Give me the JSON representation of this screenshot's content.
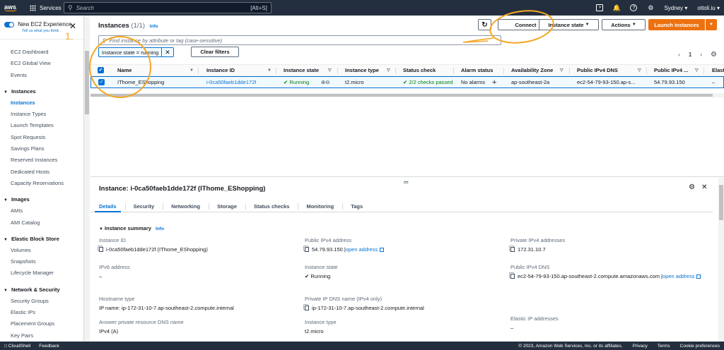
{
  "topbar": {
    "logo": "aws",
    "services_label": "Services",
    "search_placeholder": "Search",
    "search_shortcut": "[Alt+S]",
    "region": "Sydney",
    "user": "ottoli.iu",
    "icons": [
      "terminal-icon",
      "bell-icon",
      "help-icon",
      "gear-icon"
    ]
  },
  "sidebar": {
    "toggle_title": "New EC2 Experience",
    "toggle_sub": "Tell us what you think",
    "top_items": [
      "EC2 Dashboard",
      "EC2 Global View",
      "Events"
    ],
    "sections": [
      {
        "title": "Instances",
        "items": [
          "Instances",
          "Instance Types",
          "Launch Templates",
          "Spot Requests",
          "Savings Plans",
          "Reserved Instances",
          "Dedicated Hosts",
          "Capacity Reservations"
        ]
      },
      {
        "title": "Images",
        "items": [
          "AMIs",
          "AMI Catalog"
        ]
      },
      {
        "title": "Elastic Block Store",
        "items": [
          "Volumes",
          "Snapshots",
          "Lifecycle Manager"
        ]
      },
      {
        "title": "Network & Security",
        "items": [
          "Security Groups",
          "Elastic IPs",
          "Placement Groups",
          "Key Pairs"
        ]
      }
    ],
    "active_item": "Instances"
  },
  "instances": {
    "title": "Instances",
    "count": "(1/1)",
    "info": "Info",
    "buttons": {
      "connect": "Connect",
      "state": "Instance state",
      "actions": "Actions",
      "launch": "Launch instances"
    },
    "filter_placeholder": "Find instance by attribute or tag (case-sensitive)",
    "token": "Instance state = running",
    "clear": "Clear filters",
    "page": "1",
    "columns": [
      "Name",
      "Instance ID",
      "Instance state",
      "Instance type",
      "Status check",
      "Alarm status",
      "Availability Zone",
      "Public IPv4 DNS",
      "Public IPv4 ...",
      "Elast"
    ],
    "row": {
      "name": "IThome_EShopping",
      "id": "i-0ca50faeb1dde172f",
      "state": "Running",
      "type": "t2.micro",
      "status": "2/2 checks passed",
      "alarm": "No alarms",
      "az": "ap-southeast-2a",
      "dns": "ec2-54-79-93-150.ap-s...",
      "ip": "54.79.93.150",
      "elastic": "–"
    }
  },
  "detail": {
    "title": "Instance: i-0ca50faeb1dde172f (IThome_EShopping)",
    "tabs": [
      "Details",
      "Security",
      "Networking",
      "Storage",
      "Status checks",
      "Monitoring",
      "Tags"
    ],
    "summary": "Instance summary",
    "info": "Info",
    "col1": [
      {
        "label": "Instance ID",
        "value": "i-0ca50faeb1dde172f (IThome_EShopping)"
      },
      {
        "label": "IPv6 address",
        "value": "–"
      },
      {
        "label": "Hostname type",
        "value": "IP name: ip-172-31-10-7.ap-southeast-2.compute.internal"
      },
      {
        "label": "Answer private resource DNS name",
        "value": "IPv4 (A)"
      }
    ],
    "col2": [
      {
        "label": "Public IPv4 address",
        "value": "54.79.93.150",
        "link": "open address"
      },
      {
        "label": "Instance state",
        "value": "Running"
      },
      {
        "label": "Private IP DNS name (IPv4 only)",
        "value": "ip-172-31-10-7.ap-southeast-2.compute.internal"
      },
      {
        "label": "Instance type",
        "value": "t2.micro"
      }
    ],
    "col3": [
      {
        "label": "Private IPv4 addresses",
        "value": "172.31.10.7"
      },
      {
        "label": "Public IPv4 DNS",
        "value": "ec2-54-79-93-150.ap-southeast-2.compute.amazonaws.com",
        "link": "open address"
      },
      {
        "label": "Elastic IP addresses",
        "value": "–"
      }
    ]
  },
  "footer": {
    "left": [
      "CloudShell",
      "Feedback"
    ],
    "copyright": "© 2023, Amazon Web Services, Inc. or its affiliates.",
    "right": [
      "Privacy",
      "Terms",
      "Cookie preferences"
    ]
  },
  "annotation": {
    "number": "1.",
    "color": "#f5a623"
  }
}
